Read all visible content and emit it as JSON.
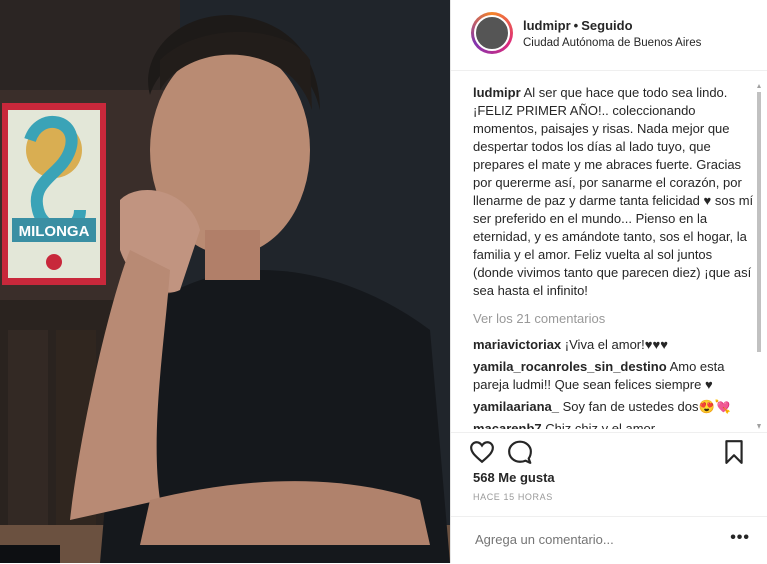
{
  "header": {
    "username": "ludmipr",
    "separator": "•",
    "follow_status": "Seguido",
    "location": "Ciudad Autónoma de Buenos Aires"
  },
  "photo": {
    "sign_text": "MILONGA",
    "sign_letter": "S"
  },
  "caption": {
    "username": "ludmipr",
    "text": "Al ser que hace que todo sea lindo. ¡FELIZ PRIMER AÑO!.. coleccionando momentos, paisajes y risas. Nada mejor que despertar todos los días al lado tuyo, que prepares el mate y me abraces fuerte. Gracias por quererme así, por sanarme el corazón, por llenarme de paz y darme tanta felicidad ♥ sos mí ser preferido en el mundo... Pienso en la eternidad, y es amándote tanto, sos el hogar, la familia y el amor. Feliz vuelta al sol juntos (donde vivimos tanto que parecen diez) ¡que así sea hasta el infinito!"
  },
  "view_all": "Ver los 21 comentarios",
  "comments": [
    {
      "user": "mariavictoriax",
      "text": "¡Viva el amor!♥♥♥"
    },
    {
      "user": "yamila_rocanroles_sin_destino",
      "text": "Amo esta pareja ludmi!! Que sean felices siempre ♥"
    },
    {
      "user": "yamilaariana_",
      "text": "Soy fan de ustedes dos😍💘"
    },
    {
      "user": "macarenb7",
      "text": "Chiz chiz y el amor"
    }
  ],
  "likes": "568 Me gusta",
  "time": "HACE 15 HORAS",
  "add_comment": {
    "placeholder": "Agrega un comentario..."
  },
  "more_label": "•••",
  "colors": {
    "accent_text": "#262626",
    "muted": "#999999",
    "border": "#efefef"
  },
  "icons": [
    "heart-icon",
    "comment-icon",
    "bookmark-icon",
    "more-icon"
  ]
}
